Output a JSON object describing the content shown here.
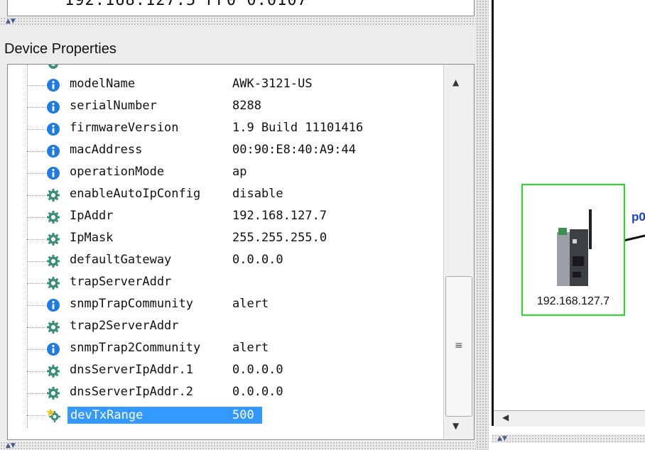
{
  "top_panel": {
    "partial_text": "192.168.127.5 FF0 0.0107"
  },
  "properties_panel": {
    "title": "Device Properties",
    "rows": [
      {
        "name": "modelName",
        "value": "AWK-3121-US",
        "icon": "info-icon"
      },
      {
        "name": "serialNumber",
        "value": "8288",
        "icon": "info-icon"
      },
      {
        "name": "firmwareVersion",
        "value": "1.9 Build 11101416",
        "icon": "info-icon"
      },
      {
        "name": "macAddress",
        "value": "00:90:E8:40:A9:44",
        "icon": "info-icon"
      },
      {
        "name": "operationMode",
        "value": "ap",
        "icon": "info-icon"
      },
      {
        "name": "enableAutoIpConfig",
        "value": "disable",
        "icon": "gear-icon"
      },
      {
        "name": "IpAddr",
        "value": "192.168.127.7",
        "icon": "gear-icon"
      },
      {
        "name": "IpMask",
        "value": "255.255.255.0",
        "icon": "gear-icon"
      },
      {
        "name": "defaultGateway",
        "value": "0.0.0.0",
        "icon": "gear-icon"
      },
      {
        "name": "trapServerAddr",
        "value": "",
        "icon": "gear-icon"
      },
      {
        "name": "snmpTrapCommunity",
        "value": "alert",
        "icon": "info-icon"
      },
      {
        "name": "trap2ServerAddr",
        "value": "",
        "icon": "gear-icon"
      },
      {
        "name": "snmpTrap2Community",
        "value": "alert",
        "icon": "info-icon"
      },
      {
        "name": "dnsServerIpAddr.1",
        "value": "0.0.0.0",
        "icon": "gear-icon"
      },
      {
        "name": "dnsServerIpAddr.2",
        "value": "0.0.0.0",
        "icon": "gear-icon"
      },
      {
        "name": "devTxRange",
        "value": "500",
        "icon": "star-gear-icon",
        "selected": true
      }
    ]
  },
  "topology": {
    "device_label": "192.168.127.7",
    "link_label": "p0"
  },
  "colors": {
    "selection": "#3399ff",
    "device_border": "#22dd22",
    "link_label": "#1a3fc4",
    "info_icon": "#1f7be0",
    "gear_icon": "#3a8f7a"
  }
}
